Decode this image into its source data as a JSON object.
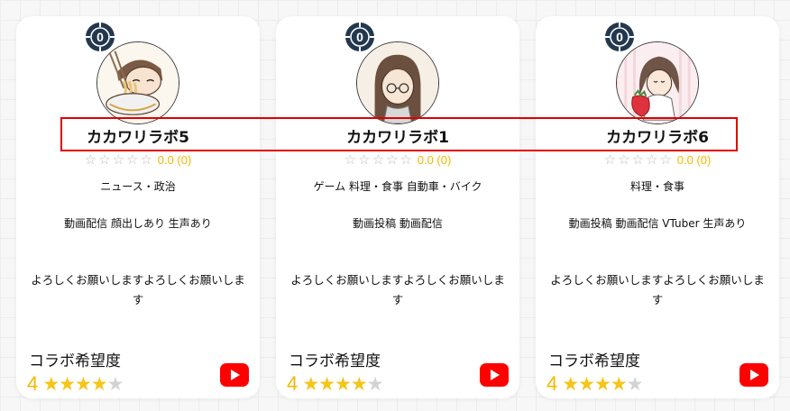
{
  "cards": [
    {
      "badge_count": "0",
      "name": "カカワリラボ5",
      "rating_stars": "☆☆☆☆☆",
      "rating_score": "0.0 (0)",
      "genres": "ニュース・政治",
      "activities": "動画配信 顔出しあり 生声あり",
      "message": "よろしくお願いしますよろしくお願いします",
      "collab_label": "コラボ希望度",
      "collab_value": "4",
      "collab_filled": "★★★★",
      "collab_empty": "★",
      "avatar_icon": "ramen-eater-avatar-icon",
      "social_icon": "youtube-icon"
    },
    {
      "badge_count": "0",
      "name": "カカワリラボ1",
      "rating_stars": "☆☆☆☆☆",
      "rating_score": "0.0 (0)",
      "genres": "ゲーム 料理・食事 自動車・バイク",
      "activities": "動画投稿 動画配信",
      "message": "よろしくお願いしますよろしくお願いします",
      "collab_label": "コラボ希望度",
      "collab_value": "4",
      "collab_filled": "★★★★",
      "collab_empty": "★",
      "avatar_icon": "glasses-girl-avatar-icon",
      "social_icon": "youtube-icon"
    },
    {
      "badge_count": "0",
      "name": "カカワリラボ6",
      "rating_stars": "☆☆☆☆☆",
      "rating_score": "0.0 (0)",
      "genres": "料理・食事",
      "activities": "動画投稿 動画配信 VTuber 生声あり",
      "message": "よろしくお願いしますよろしくお願いします",
      "collab_label": "コラボ希望度",
      "collab_value": "4",
      "collab_filled": "★★★★",
      "collab_empty": "★",
      "avatar_icon": "strawberry-girl-avatar-icon",
      "social_icon": "youtube-icon"
    }
  ],
  "colors": {
    "badge": "#23384f",
    "accent_yellow": "#f5b800",
    "youtube_red": "#ff0000",
    "highlight_red": "#e00000"
  }
}
